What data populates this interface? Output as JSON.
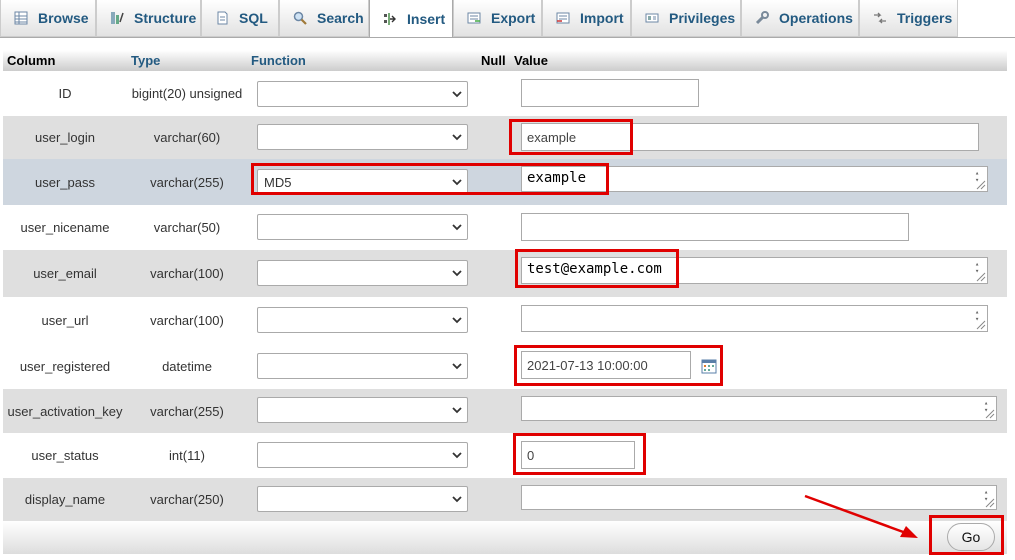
{
  "tabs": [
    {
      "label": "Browse",
      "icon": "browse-icon"
    },
    {
      "label": "Structure",
      "icon": "structure-icon"
    },
    {
      "label": "SQL",
      "icon": "sql-icon"
    },
    {
      "label": "Search",
      "icon": "search-icon"
    },
    {
      "label": "Insert",
      "icon": "insert-icon",
      "active": true
    },
    {
      "label": "Export",
      "icon": "export-icon"
    },
    {
      "label": "Import",
      "icon": "import-icon"
    },
    {
      "label": "Privileges",
      "icon": "privileges-icon"
    },
    {
      "label": "Operations",
      "icon": "operations-icon"
    },
    {
      "label": "Triggers",
      "icon": "triggers-icon"
    }
  ],
  "table": {
    "headers": {
      "column": "Column",
      "type": "Type",
      "function": "Function",
      "null": "Null",
      "value": "Value"
    },
    "rows": [
      {
        "name": "ID",
        "type": "bigint(20) unsigned",
        "function": "",
        "value": ""
      },
      {
        "name": "user_login",
        "type": "varchar(60)",
        "function": "",
        "value": "example"
      },
      {
        "name": "user_pass",
        "type": "varchar(255)",
        "function": "MD5",
        "value": "example"
      },
      {
        "name": "user_nicename",
        "type": "varchar(50)",
        "function": "",
        "value": ""
      },
      {
        "name": "user_email",
        "type": "varchar(100)",
        "function": "",
        "value": "test@example.com"
      },
      {
        "name": "user_url",
        "type": "varchar(100)",
        "function": "",
        "value": ""
      },
      {
        "name": "user_registered",
        "type": "datetime",
        "function": "",
        "value": "2021-07-13 10:00:00"
      },
      {
        "name": "user_activation_key",
        "type": "varchar(255)",
        "function": "",
        "value": ""
      },
      {
        "name": "user_status",
        "type": "int(11)",
        "function": "",
        "value": "0"
      },
      {
        "name": "display_name",
        "type": "varchar(250)",
        "function": "",
        "value": ""
      }
    ]
  },
  "footer": {
    "go_label": "Go"
  },
  "colors": {
    "tab_text": "#235a81",
    "highlight_row": "#ced6df",
    "annotation": "#e00000"
  }
}
